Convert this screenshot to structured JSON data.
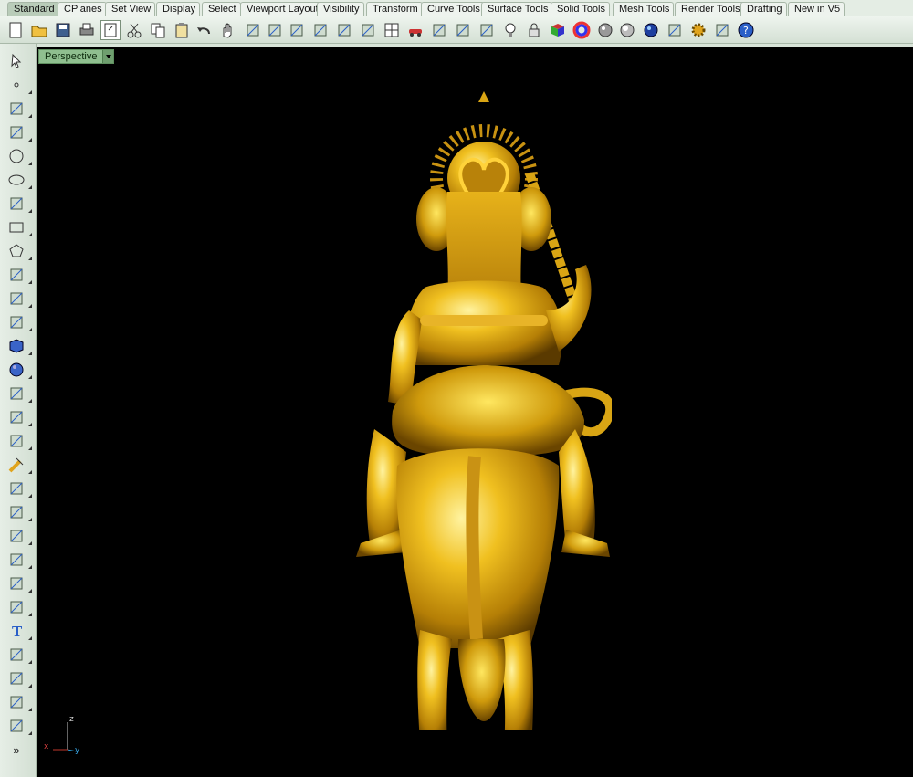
{
  "tabs": [
    {
      "label": "Standard",
      "active": true
    },
    {
      "label": "CPlanes"
    },
    {
      "label": "Set View"
    },
    {
      "label": "Display"
    },
    {
      "label": "Select"
    },
    {
      "label": "Viewport Layout"
    },
    {
      "label": "Visibility"
    },
    {
      "label": "Transform"
    },
    {
      "label": "Curve Tools"
    },
    {
      "label": "Surface Tools"
    },
    {
      "label": "Solid Tools"
    },
    {
      "label": "Mesh Tools"
    },
    {
      "label": "Render Tools"
    },
    {
      "label": "Drafting"
    },
    {
      "label": "New in V5"
    }
  ],
  "toolbar_icons": [
    "new-icon",
    "open-icon",
    "save-icon",
    "print-icon",
    "import-icon",
    "cut-icon",
    "copy-icon",
    "paste-icon",
    "undo-icon",
    "pan-icon",
    "rotate-view-icon",
    "zoom-dynamic-icon",
    "zoom-window-icon",
    "zoom-extents-icon",
    "zoom-selected-icon",
    "undo-view-icon",
    "four-viewports-icon",
    "car-icon",
    "layer-icon",
    "object-properties-icon",
    "osnap-icon",
    "lightbulb-icon",
    "lock-icon",
    "material-icon",
    "color-wheel-icon",
    "shaded-sphere-icon",
    "rendered-sphere-icon",
    "render-icon",
    "options-icon",
    "settings-gear-icon",
    "grid-snap-icon",
    "help-icon"
  ],
  "sidebar_icons": [
    "select-arrow-icon",
    "point-icon",
    "polyline-icon",
    "curve-icon",
    "circle-icon",
    "ellipse-icon",
    "arc-icon",
    "rectangle-icon",
    "polygon-icon",
    "freeform-curve-icon",
    "surface-edge-icon",
    "surface-icon",
    "box-solid-icon",
    "sphere-solid-icon",
    "extrude-icon",
    "mesh-icon",
    "explode-icon",
    "fillet-icon",
    "trim-icon",
    "split-icon",
    "boolean-icon",
    "array-icon",
    "curve-from-object-icon",
    "offset-icon",
    "text-icon",
    "dimension-icon",
    "group-icon",
    "layout-icon",
    "block-icon",
    "more-icon"
  ],
  "sidebar_more_label": "»",
  "viewport": {
    "title": "Perspective",
    "axes": {
      "z": "z",
      "x": "x",
      "y": "y"
    }
  },
  "colors": {
    "viewport_bg": "#000000",
    "gold": "#d9a514",
    "active_tab": "#b9ccb9",
    "viewport_label_bg": "#8fbf8f"
  }
}
